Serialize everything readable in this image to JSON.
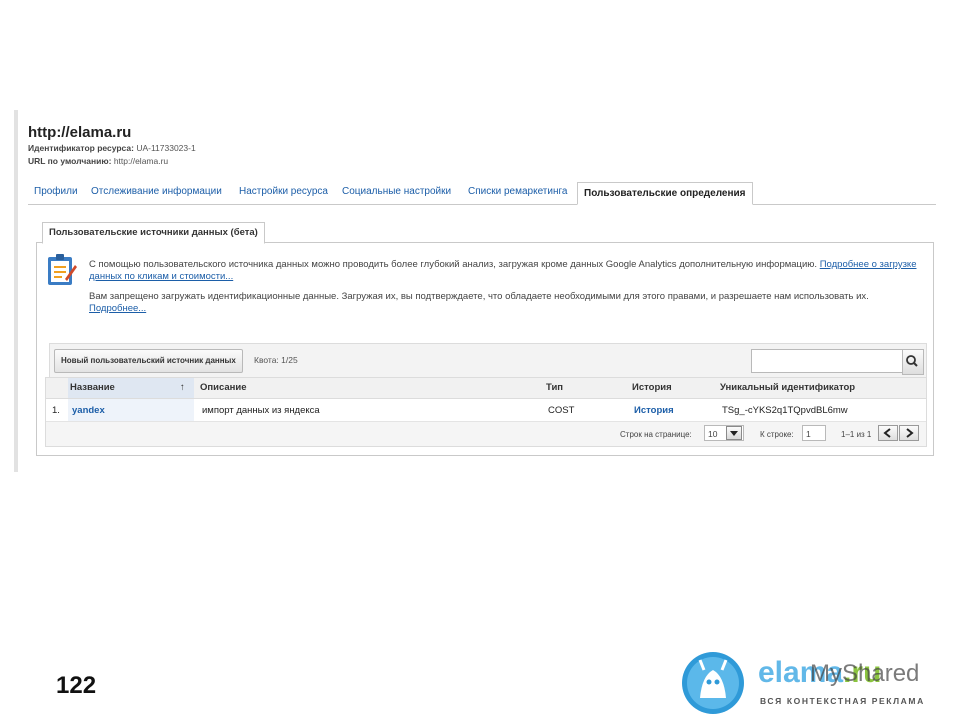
{
  "header": {
    "site_title": "http://elama.ru",
    "resource_id_label": "Идентификатор ресурса:",
    "resource_id_value": "UA-11733023-1",
    "default_url_label": "URL по умолчанию:",
    "default_url_value": "http://elama.ru"
  },
  "tabs": [
    {
      "label": "Профили"
    },
    {
      "label": "Отслеживание информации"
    },
    {
      "label": "Настройки ресурса"
    },
    {
      "label": "Социальные настройки"
    },
    {
      "label": "Списки ремаркетинга"
    },
    {
      "label": "Пользовательские определения"
    }
  ],
  "subtab": "Пользовательские источники данных (бета)",
  "info": {
    "line1": "С помощью пользовательского источника данных можно проводить более глубокий анализ, загружая кроме данных Google Analytics дополнительную информацию.",
    "link1": "Подробнее о загрузке данных по кликам и стоимости...",
    "line2": "Вам запрещено загружать идентификационные данные. Загружая их, вы подтверждаете, что обладаете необходимыми для этого правами, и разрешаете нам использовать их.",
    "link2": "Подробнее..."
  },
  "toolbar": {
    "new_source_label": "Новый пользовательский источник данных",
    "quota": "Квота: 1/25",
    "search_value": ""
  },
  "table": {
    "columns": [
      "Название",
      "Описание",
      "Тип",
      "История",
      "Уникальный идентификатор"
    ],
    "sort_arrow": "↑",
    "rows": [
      {
        "num": "1.",
        "name": "yandex",
        "description": "импорт данных из яндекса",
        "type": "COST",
        "history": "История",
        "id": "TSg_-cYKS2q1TQpvdBL6mw"
      }
    ]
  },
  "footer": {
    "rows_per_page_label": "Строк на странице:",
    "rows_per_page_value": "10",
    "goto_label": "К строке:",
    "goto_value": "1",
    "range": "1–1 из 1"
  },
  "slide_number": "122",
  "logo": {
    "text_main": "elama",
    "text_suffix": ".ru",
    "tagline": "ВСЯ КОНТЕКСТНАЯ РЕКЛАМА",
    "watermark": "MyShared"
  },
  "colors": {
    "link": "#1c5ea8",
    "logo_blue": "#62b8e8",
    "logo_green": "#8bc43f"
  }
}
